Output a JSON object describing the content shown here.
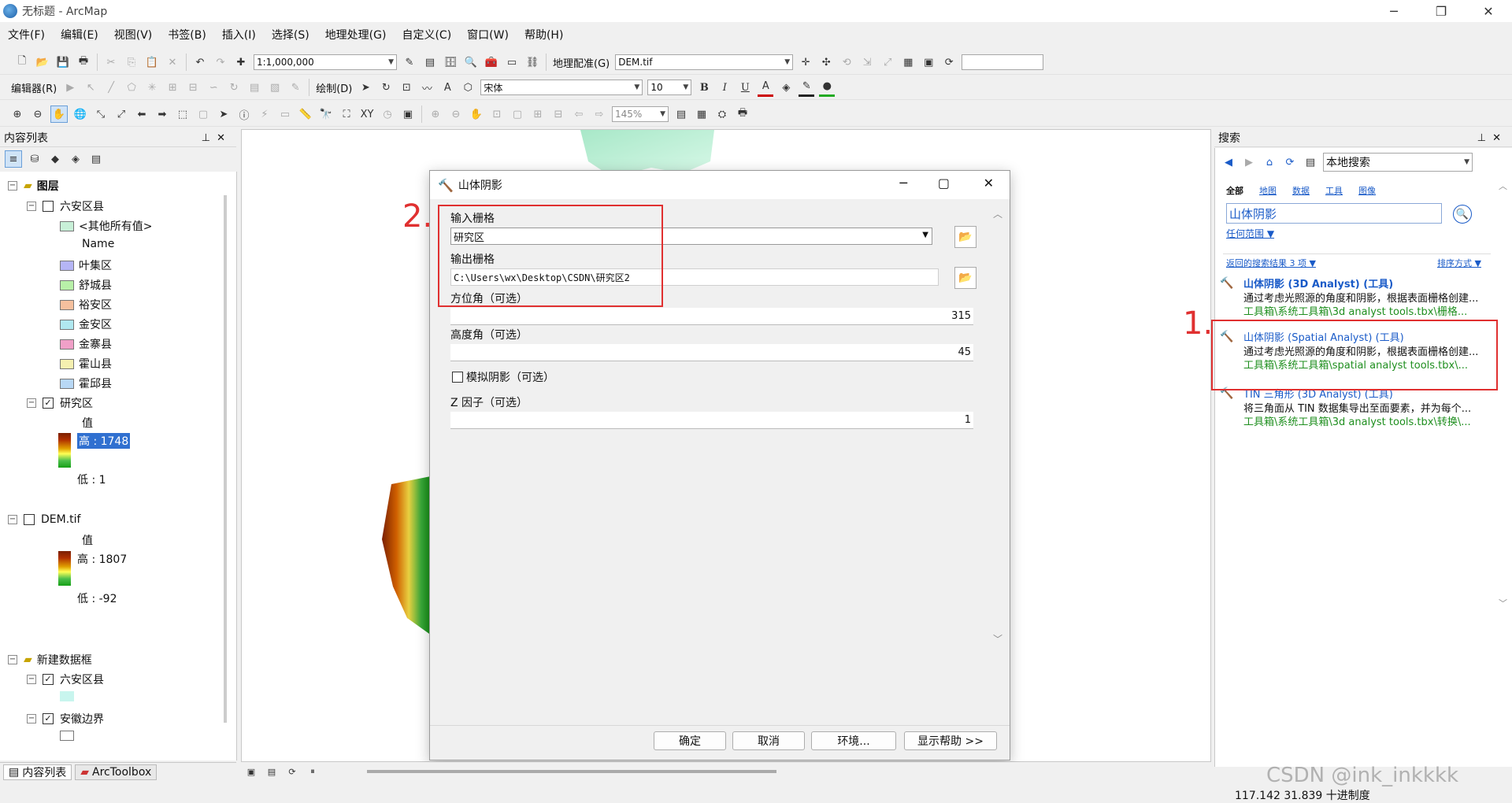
{
  "window": {
    "title": "无标题 - ArcMap"
  },
  "menus": [
    "文件(F)",
    "编辑(E)",
    "视图(V)",
    "书签(B)",
    "插入(I)",
    "选择(S)",
    "地理处理(G)",
    "自定义(C)",
    "窗口(W)",
    "帮助(H)"
  ],
  "toolbar": {
    "scale": "1:1,000,000",
    "georef_label": "地理配准(G)",
    "georef_layer": "DEM.tif",
    "editor_label": "编辑器(R)",
    "draw_label": "绘制(D)",
    "font_name": "宋体",
    "font_size": "10",
    "bold": "B",
    "italic": "I",
    "underline": "U",
    "zoom_pct": "145%"
  },
  "toc": {
    "title": "内容列表",
    "layers_label": "图层",
    "group1": "六安区县",
    "other_values": "<其他所有值>",
    "name_header": "Name",
    "classes": [
      {
        "label": "叶集区",
        "color": "#b5b5f5"
      },
      {
        "label": "舒城县",
        "color": "#b8f0a8"
      },
      {
        "label": "裕安区",
        "color": "#f5c09e"
      },
      {
        "label": "金安区",
        "color": "#b0e8f0"
      },
      {
        "label": "金寨县",
        "color": "#f0a0c8"
      },
      {
        "label": "霍山县",
        "color": "#f5f0b0"
      },
      {
        "label": "霍邱县",
        "color": "#b8d8f5"
      }
    ],
    "study_area": "研究区",
    "value_label": "值",
    "study_high": "高 : 1748",
    "study_low": "低 : 1",
    "dem": "DEM.tif",
    "dem_value_label": "值",
    "dem_high": "高 : 1807",
    "dem_low": "低 : -92",
    "new_frame": "新建数据框",
    "group2": "六安区县",
    "anhui": "安徽边界",
    "tab_toc": "内容列表",
    "tab_toolbox": "ArcToolbox"
  },
  "dialog": {
    "title": "山体阴影",
    "input_label": "输入栅格",
    "input_value": "研究区",
    "output_label": "输出栅格",
    "output_value": "C:\\Users\\wx\\Desktop\\CSDN\\研究区2",
    "azimuth_label": "方位角（可选）",
    "azimuth_value": "315",
    "altitude_label": "高度角（可选）",
    "altitude_value": "45",
    "model_shadows_label": "模拟阴影（可选）",
    "zfactor_label": "Z 因子（可选）",
    "zfactor_value": "1",
    "ok": "确定",
    "cancel": "取消",
    "env": "环境...",
    "help": "显示帮助 >>"
  },
  "search": {
    "title": "搜索",
    "scope": "本地搜索",
    "filters": [
      "全部",
      "地图",
      "数据",
      "工具",
      "图像"
    ],
    "query": "山体阴影",
    "extent": "任何范围",
    "results_count": "返回的搜索结果 3 项",
    "sort": "排序方式",
    "results": [
      {
        "title": "山体阴影 (3D Analyst) (工具)",
        "desc": "通过考虑光照源的角度和阴影，根据表面栅格创建...",
        "path": "工具箱\\系统工具箱\\3d analyst tools.tbx\\栅格..."
      },
      {
        "title": "山体阴影 (Spatial Analyst) (工具)",
        "desc": "通过考虑光照源的角度和阴影，根据表面栅格创建...",
        "path": "工具箱\\系统工具箱\\spatial analyst tools.tbx\\..."
      },
      {
        "title": "TIN 三角形 (3D Analyst) (工具)",
        "desc": "将三角面从 TIN 数据集导出至面要素，并为每个...",
        "path": "工具箱\\系统工具箱\\3d analyst tools.tbx\\转换\\..."
      }
    ]
  },
  "annotations": {
    "one": "1.",
    "two": "2."
  },
  "status": {
    "coords": "117.142  31.839 十进制度"
  },
  "watermark": "CSDN @ink_inkkkk"
}
